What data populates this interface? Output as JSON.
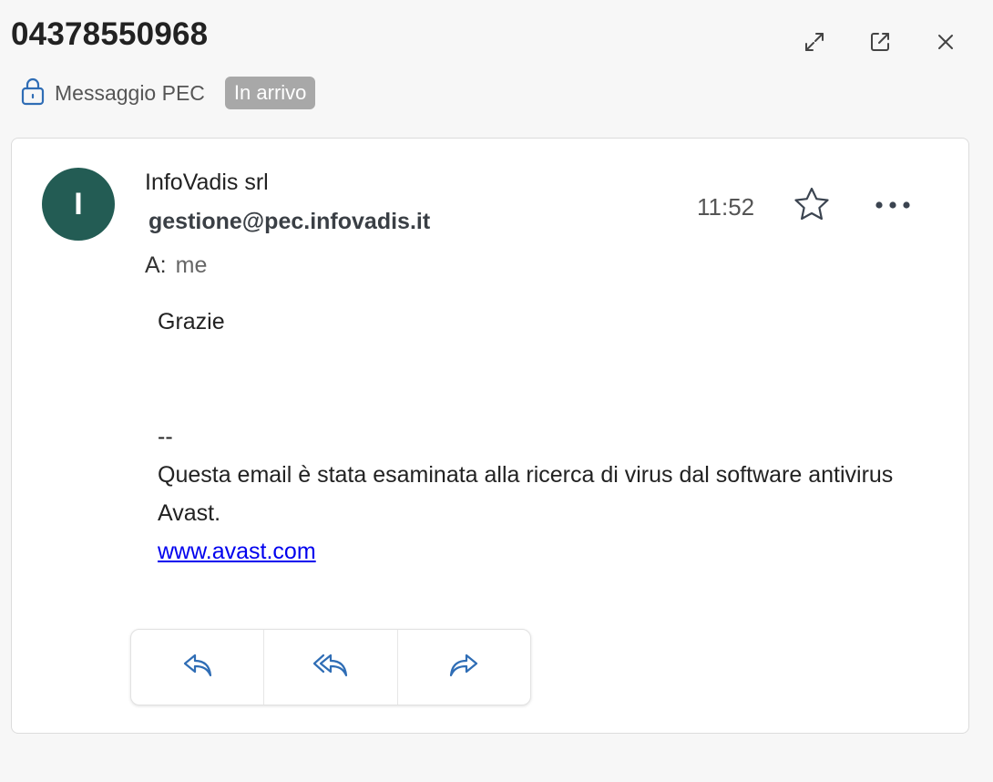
{
  "window": {
    "title": "04378550968",
    "icons": [
      "expand-icon",
      "open-external-icon",
      "close-icon"
    ]
  },
  "pec": {
    "label": "Messaggio PEC",
    "badge": "In arrivo",
    "icon": "lock-icon"
  },
  "message": {
    "avatar_initial": "I",
    "avatar_color": "#235c54",
    "sender_name": "InfoVadis srl",
    "sender_email": "gestione@pec.infovadis.it",
    "to_label": "A:",
    "to_value": "me",
    "time": "11:52",
    "body": {
      "greeting": "Grazie",
      "separator": "--",
      "antivirus_text": "Questa email è stata esaminata alla ricerca di virus dal software antivirus Avast.",
      "link": "www.avast.com"
    }
  },
  "actions": [
    "reply-icon",
    "reply-all-icon",
    "forward-icon"
  ],
  "colors": {
    "accent": "#2f6db5",
    "badge_bg": "#a8a8a8"
  }
}
